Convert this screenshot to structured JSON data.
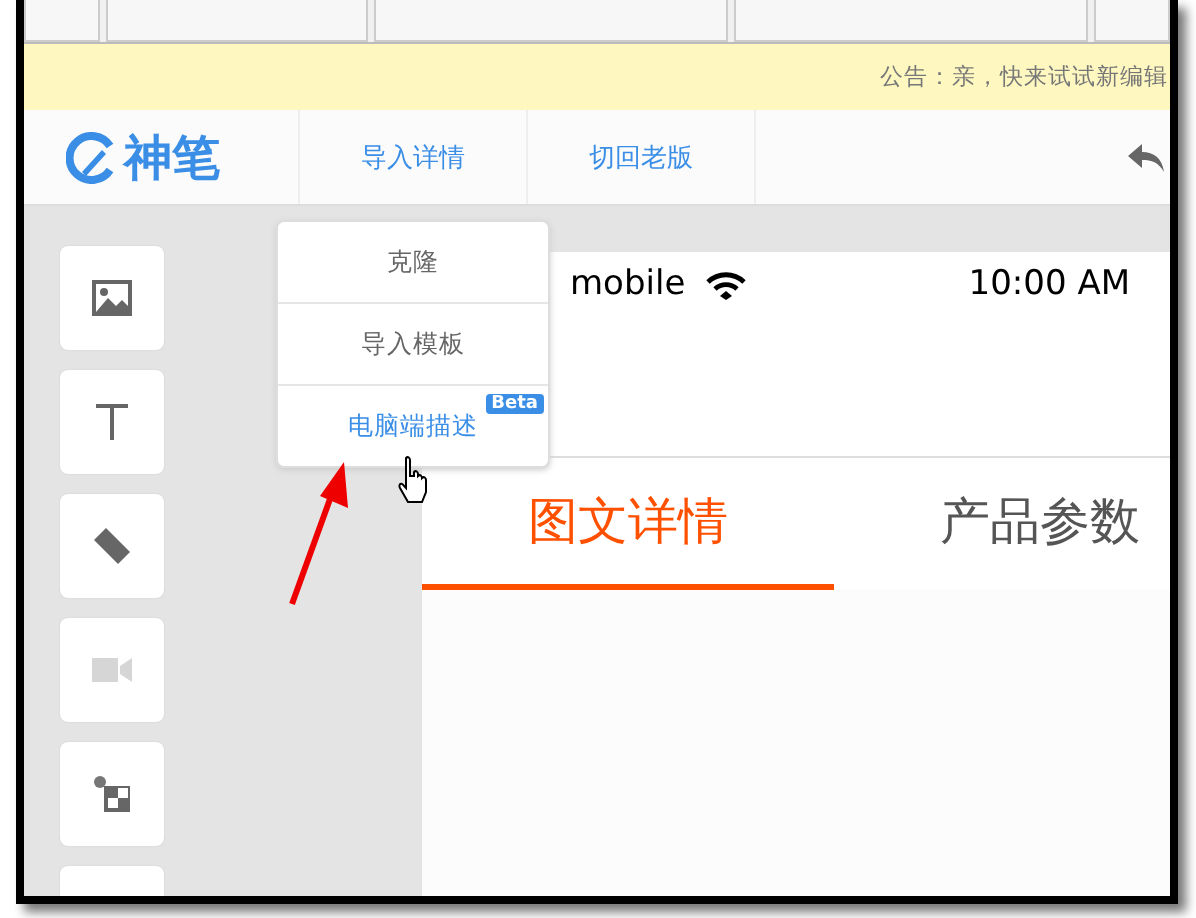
{
  "notice": {
    "text": "公告：亲，快来试试新编辑"
  },
  "header": {
    "logo": "神笔",
    "nav": [
      {
        "label": "导入详情"
      },
      {
        "label": "切回老版"
      }
    ]
  },
  "tools": [
    {
      "kind": "image"
    },
    {
      "kind": "text"
    },
    {
      "kind": "ruler"
    },
    {
      "kind": "video"
    },
    {
      "kind": "modules"
    },
    {
      "kind": "blank"
    }
  ],
  "dropdown": {
    "items": [
      {
        "label": "克隆",
        "kind": "plain"
      },
      {
        "label": "导入模板",
        "kind": "plain"
      },
      {
        "label": "电脑端描述",
        "kind": "link",
        "badge": "Beta"
      }
    ]
  },
  "phone": {
    "carrier": "mobile",
    "time": "10:00 AM",
    "tabs": [
      {
        "label": "图文详情",
        "selected": true
      },
      {
        "label": "产品参数",
        "selected": false
      }
    ]
  }
}
